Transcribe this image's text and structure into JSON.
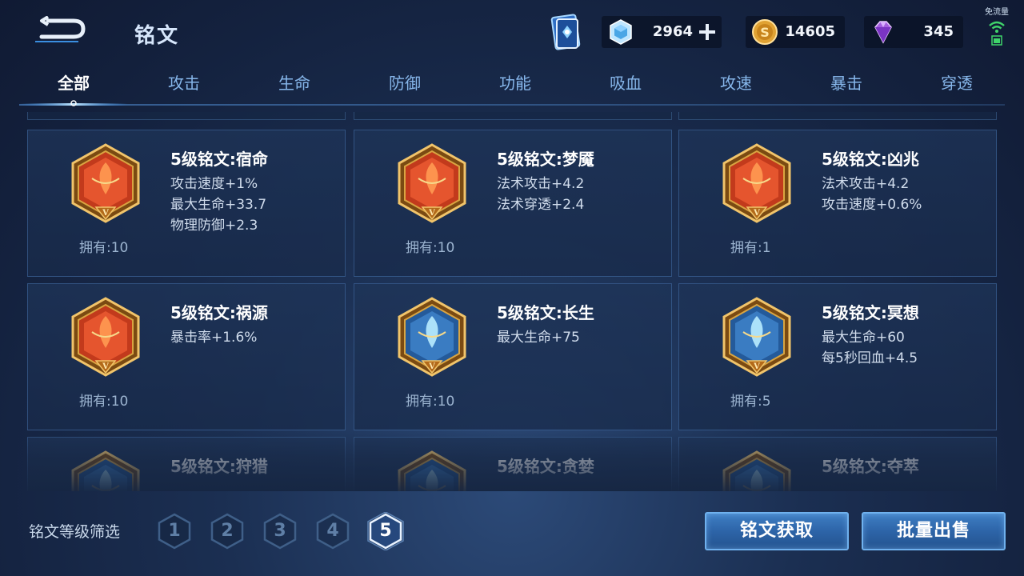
{
  "header": {
    "title": "铭文",
    "currencies": {
      "coupon": {
        "icon": "diamond-coupon-icon",
        "value": "2964"
      },
      "gold": {
        "icon": "gold-coin-icon",
        "value": "14605"
      },
      "gem": {
        "icon": "purple-gem-icon",
        "value": "345"
      }
    },
    "network": {
      "label": "免流量",
      "icon": "wifi-icon"
    }
  },
  "tabs": [
    {
      "label": "全部",
      "active": true
    },
    {
      "label": "攻击",
      "active": false
    },
    {
      "label": "生命",
      "active": false
    },
    {
      "label": "防御",
      "active": false
    },
    {
      "label": "功能",
      "active": false
    },
    {
      "label": "吸血",
      "active": false
    },
    {
      "label": "攻速",
      "active": false
    },
    {
      "label": "暴击",
      "active": false
    },
    {
      "label": "穿透",
      "active": false
    }
  ],
  "inscriptions": [
    {
      "name": "5级铭文:宿命",
      "color": "red",
      "stats": [
        "攻击速度+1%",
        "最大生命+33.7",
        "物理防御+2.3"
      ],
      "owned": "拥有:10"
    },
    {
      "name": "5级铭文:梦魇",
      "color": "red",
      "stats": [
        "法术攻击+4.2",
        "法术穿透+2.4"
      ],
      "owned": "拥有:10"
    },
    {
      "name": "5级铭文:凶兆",
      "color": "red",
      "stats": [
        "法术攻击+4.2",
        "攻击速度+0.6%"
      ],
      "owned": "拥有:1"
    },
    {
      "name": "5级铭文:祸源",
      "color": "red",
      "stats": [
        "暴击率+1.6%"
      ],
      "owned": "拥有:10"
    },
    {
      "name": "5级铭文:长生",
      "color": "blue",
      "stats": [
        "最大生命+75"
      ],
      "owned": "拥有:10"
    },
    {
      "name": "5级铭文:冥想",
      "color": "blue",
      "stats": [
        "最大生命+60",
        "每5秒回血+4.5"
      ],
      "owned": "拥有:5"
    },
    {
      "name": "5级铭文:狩猎",
      "color": "blue",
      "stats": [],
      "owned": ""
    },
    {
      "name": "5级铭文:贪婪",
      "color": "blue",
      "stats": [],
      "owned": ""
    },
    {
      "name": "5级铭文:夺萃",
      "color": "blue",
      "stats": [],
      "owned": ""
    }
  ],
  "footer": {
    "filter_label": "铭文等级筛选",
    "levels": [
      {
        "label": "1",
        "active": false
      },
      {
        "label": "2",
        "active": false
      },
      {
        "label": "3",
        "active": false
      },
      {
        "label": "4",
        "active": false
      },
      {
        "label": "5",
        "active": true
      }
    ],
    "get_button": "铭文获取",
    "sell_button": "批量出售"
  },
  "colors": {
    "red_emblem": "#d8452a",
    "blue_emblem": "#3a7cc2",
    "gold_frame": "#d9a441",
    "accent_blue": "#6fb1ee"
  }
}
